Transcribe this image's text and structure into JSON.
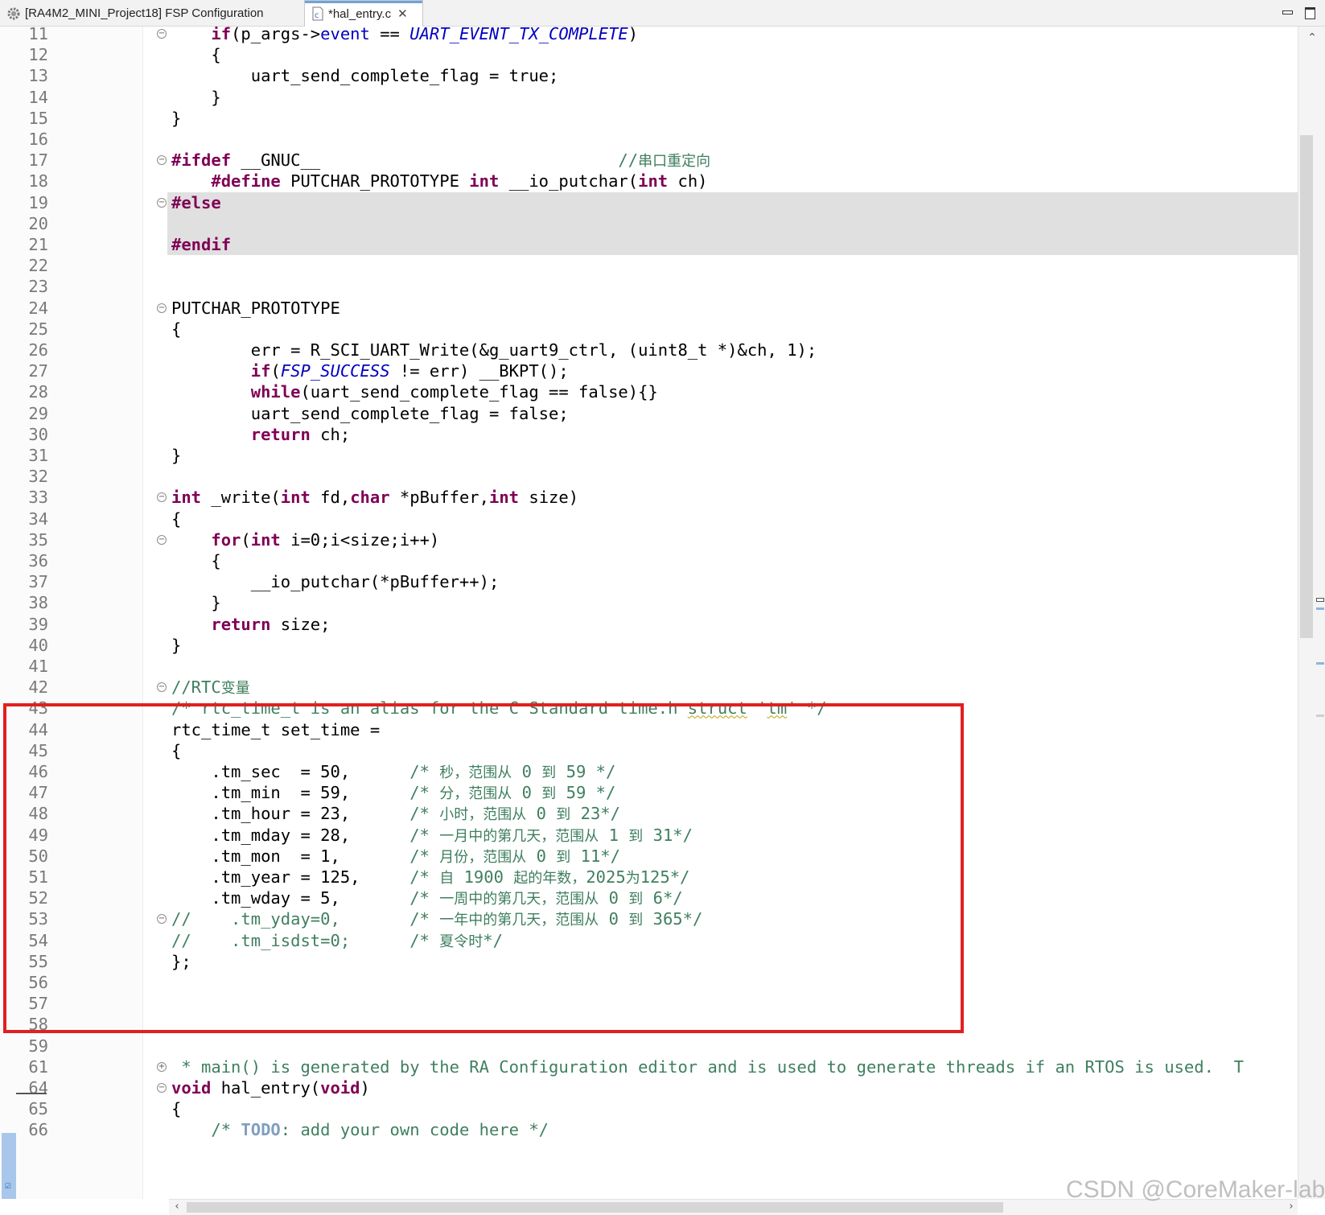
{
  "tabs": [
    {
      "label": "[RA4M2_MINI_Project18] FSP Configuration",
      "icon": "gear-icon"
    },
    {
      "label": "*hal_entry.c",
      "icon": "c-file-icon",
      "close": "✕"
    }
  ],
  "window": {
    "minimize": "minimize-icon",
    "maximize": "maximize-icon"
  },
  "lines": [
    {
      "n": "11",
      "fold": "⊖",
      "html": "    <span class=\"kw\">if</span>(p_args-><span style=\"color:#0000c0\">event</span> == <span class=\"enum\">UART_EVENT_TX_COMPLETE</span>)"
    },
    {
      "n": "12",
      "html": "    {"
    },
    {
      "n": "13",
      "html": "        uart_send_complete_flag = true;"
    },
    {
      "n": "14",
      "html": "    }"
    },
    {
      "n": "15",
      "html": "}"
    },
    {
      "n": "16",
      "html": ""
    },
    {
      "n": "17",
      "fold": "⊖",
      "html": "<span class=\"pp\">#ifdef</span> __GNUC__                              <span class=\"cm\">//<span class=\"cm-cn\">串口重定向</span></span>"
    },
    {
      "n": "18",
      "html": "    <span class=\"pp\">#define</span> PUTCHAR_PROTOTYPE <span class=\"kw\">int</span> __io_putchar(<span class=\"kw\">int</span> ch)"
    },
    {
      "n": "19",
      "fold": "⊖",
      "inactive": true,
      "html": "<span class=\"pp\">#else</span>"
    },
    {
      "n": "20",
      "inactive": true,
      "html": ""
    },
    {
      "n": "21",
      "inactive": true,
      "html": "<span class=\"pp\">#endif</span>"
    },
    {
      "n": "22",
      "html": ""
    },
    {
      "n": "23",
      "html": ""
    },
    {
      "n": "24",
      "fold": "⊖",
      "html": "PUTCHAR_PROTOTYPE"
    },
    {
      "n": "25",
      "html": "{"
    },
    {
      "n": "26",
      "html": "        err = R_SCI_UART_Write(&amp;g_uart9_ctrl, (uint8_t *)&amp;ch, 1);"
    },
    {
      "n": "27",
      "html": "        <span class=\"kw\">if</span>(<span class=\"enum\">FSP_SUCCESS</span> != err) __BKPT();"
    },
    {
      "n": "28",
      "html": "        <span class=\"kw\">while</span>(uart_send_complete_flag == false){}"
    },
    {
      "n": "29",
      "html": "        uart_send_complete_flag = false;"
    },
    {
      "n": "30",
      "html": "        <span class=\"kw\">return</span> ch;"
    },
    {
      "n": "31",
      "html": "}"
    },
    {
      "n": "32",
      "html": ""
    },
    {
      "n": "33",
      "fold": "⊖",
      "html": "<span class=\"kw\">int</span> _write(<span class=\"kw\">int</span> fd,<span class=\"kw\">char</span> *pBuffer,<span class=\"kw\">int</span> size)"
    },
    {
      "n": "34",
      "html": "{"
    },
    {
      "n": "35",
      "fold": "⊖",
      "html": "    <span class=\"kw\">for</span>(<span class=\"kw\">int</span> i=0;i&lt;size;i++)"
    },
    {
      "n": "36",
      "html": "    {"
    },
    {
      "n": "37",
      "html": "        __io_putchar(*pBuffer++);"
    },
    {
      "n": "38",
      "html": "    }"
    },
    {
      "n": "39",
      "html": "    <span class=\"kw\">return</span> size;"
    },
    {
      "n": "40",
      "html": "}"
    },
    {
      "n": "41",
      "html": ""
    },
    {
      "n": "42",
      "fold": "⊖",
      "html": "<span class=\"cm\">//RTC<span class=\"cm-cn\">变量</span></span>"
    },
    {
      "n": "43",
      "html": "<span class=\"cm\">/* rtc_time_t is an alias for the C Standard time.h <span class=\"sq\">struct</span> '<span class=\"sq\">tm</span>' */</span>"
    },
    {
      "n": "44",
      "html": "rtc_time_t set_time ="
    },
    {
      "n": "45",
      "html": "{"
    },
    {
      "n": "46",
      "html": "    .tm_sec  = 50,      <span class=\"cm\">/* <span class=\"cm-cn\">秒，范围从</span> 0 <span class=\"cm-cn\">到</span> 59 */</span>"
    },
    {
      "n": "47",
      "html": "    .tm_min  = 59,      <span class=\"cm\">/* <span class=\"cm-cn\">分，范围从</span> 0 <span class=\"cm-cn\">到</span> 59 */</span>"
    },
    {
      "n": "48",
      "html": "    .tm_hour = 23,      <span class=\"cm\">/* <span class=\"cm-cn\">小时，范围从</span> 0 <span class=\"cm-cn\">到</span> 23*/</span>"
    },
    {
      "n": "49",
      "html": "    .tm_mday = 28,      <span class=\"cm\">/* <span class=\"cm-cn\">一月中的第几天，范围从</span> 1 <span class=\"cm-cn\">到</span> 31*/</span>"
    },
    {
      "n": "50",
      "html": "    .tm_mon  = 1,       <span class=\"cm\">/* <span class=\"cm-cn\">月份，范围从</span> 0 <span class=\"cm-cn\">到</span> 11*/</span>"
    },
    {
      "n": "51",
      "html": "    .tm_year = 125,     <span class=\"cm\">/* <span class=\"cm-cn\">自</span> 1900 <span class=\"cm-cn\">起的年数，</span>2025<span class=\"cm-cn\">为</span>125*/</span>"
    },
    {
      "n": "52",
      "html": "    .tm_wday = 5,       <span class=\"cm\">/* <span class=\"cm-cn\">一周中的第几天，范围从</span> 0 <span class=\"cm-cn\">到</span> 6*/</span>"
    },
    {
      "n": "53",
      "fold": "⊖",
      "html": "<span class=\"cm\">//    .tm_yday=0,       /* <span class=\"cm-cn\">一年中的第几天，范围从</span> 0 <span class=\"cm-cn\">到</span> 365*/</span>"
    },
    {
      "n": "54",
      "html": "<span class=\"cm\">//    .tm_isdst=0;      /* <span class=\"cm-cn\">夏令时</span>*/</span>"
    },
    {
      "n": "55",
      "html": "};"
    },
    {
      "n": "56",
      "html": ""
    },
    {
      "n": "57",
      "html": ""
    },
    {
      "n": "58",
      "html": ""
    },
    {
      "n": "59",
      "html": ""
    },
    {
      "n": "61",
      "fold": "⊕",
      "html": "<span class=\"cm\"> * main() is generated by the RA Configuration editor and is used to generate threads if an RTOS is used.  T</span>"
    },
    {
      "n": "64",
      "fold": "⊖",
      "html": "<span class=\"kw\">void</span> hal_entry(<span class=\"kw\">void</span>)"
    },
    {
      "n": "65",
      "html": "{"
    },
    {
      "n": "66",
      "html": "    <span class=\"cm\">/* <span class=\"todo\">TODO</span>: add your own code here */</span>"
    }
  ],
  "watermark": "CSDN @CoreMaker-lab",
  "colors": {
    "keyword": "#7f0055",
    "enum": "#0000c0",
    "comment": "#3f7f5f",
    "annotation_box": "#e02020"
  }
}
